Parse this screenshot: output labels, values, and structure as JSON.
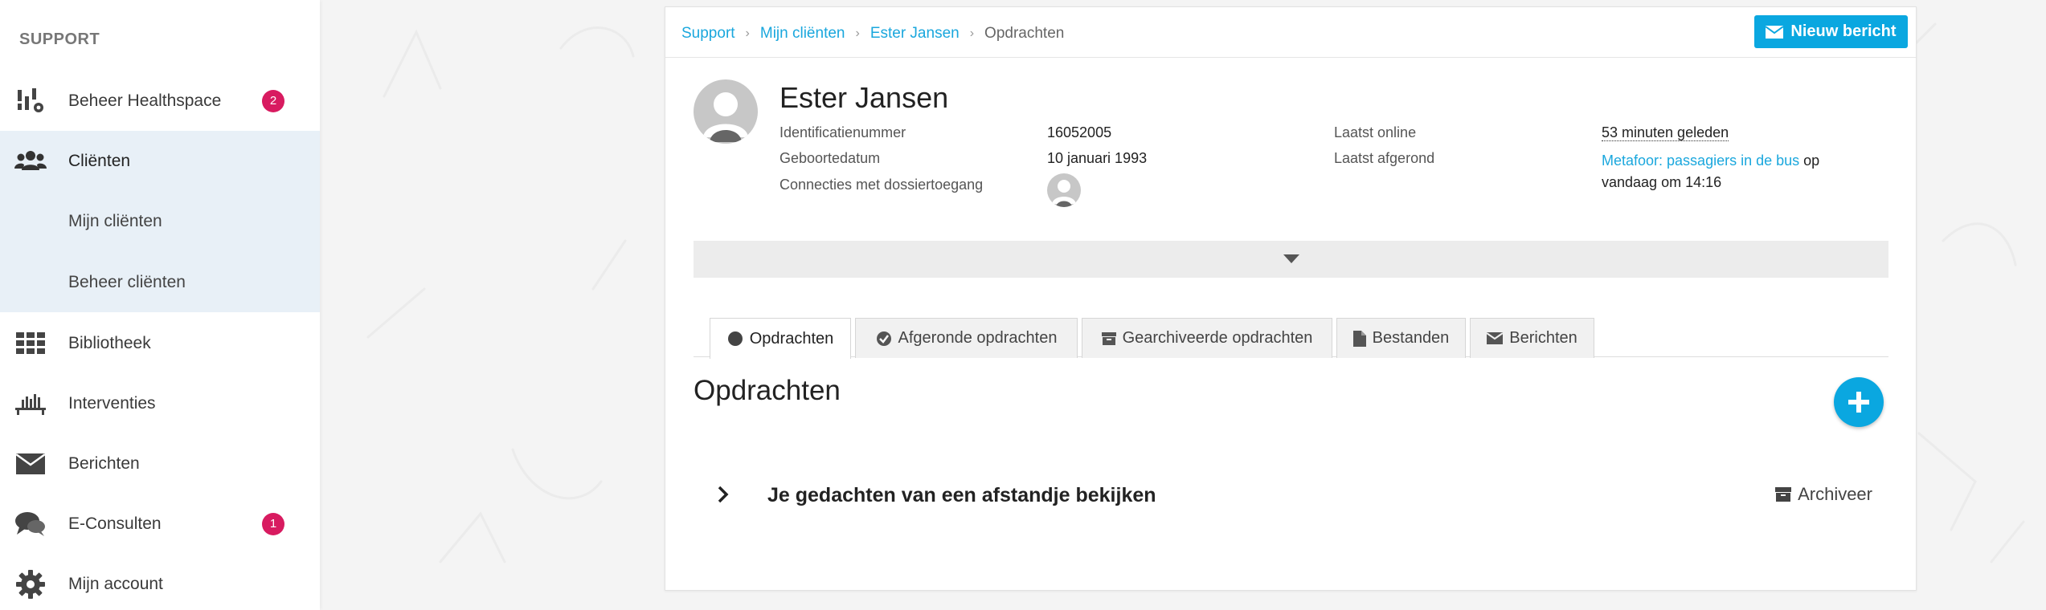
{
  "sidebar": {
    "heading": "SUPPORT",
    "items": [
      {
        "label": "Beheer Healthspace",
        "icon": "healthspace-settings-icon",
        "badge": "2"
      },
      {
        "label": "Cliënten",
        "icon": "users-icon",
        "badge": null
      },
      {
        "label": "Bibliotheek",
        "icon": "grid-icon",
        "badge": null
      },
      {
        "label": "Interventies",
        "icon": "interventions-icon",
        "badge": null
      },
      {
        "label": "Berichten",
        "icon": "envelope-icon",
        "badge": null
      },
      {
        "label": "E-Consulten",
        "icon": "chat-icon",
        "badge": "1"
      },
      {
        "label": "Mijn account",
        "icon": "gear-icon",
        "badge": null
      }
    ],
    "sub_items": [
      "Mijn cliënten",
      "Beheer cliënten"
    ],
    "active_bg": "#e8f0f7",
    "badge_color": "#d81b60"
  },
  "breadcrumb": {
    "items": [
      "Support",
      "Mijn cliënten",
      "Ester Jansen"
    ],
    "current": "Opdrachten"
  },
  "header": {
    "new_message_label": "Nieuw bericht",
    "accent": "#0aa7e0"
  },
  "client": {
    "name": "Ester Jansen",
    "id_label": "Identificatienummer",
    "id_value": "16052005",
    "dob_label": "Geboortedatum",
    "dob_value": "10 januari 1993",
    "connections_label": "Connecties met dossiertoegang",
    "last_online_label": "Laatst online",
    "last_online_value": "53 minuten geleden",
    "last_completed_label": "Laatst afgerond",
    "last_completed_link": "Metafoor: passagiers in de bus",
    "last_completed_suffix": " op",
    "last_completed_time": "vandaag om 14:16"
  },
  "tabs": [
    {
      "label": "Opdrachten",
      "icon": "circle-icon",
      "active": true
    },
    {
      "label": "Afgeronde opdrachten",
      "icon": "check-circle-icon",
      "active": false
    },
    {
      "label": "Gearchiveerde opdrachten",
      "icon": "archive-icon",
      "active": false
    },
    {
      "label": "Bestanden",
      "icon": "file-icon",
      "active": false
    },
    {
      "label": "Berichten",
      "icon": "envelope-icon",
      "active": false
    }
  ],
  "main": {
    "section_title": "Opdrachten",
    "tasks": [
      {
        "title": "Je gedachten van een afstandje bekijken",
        "archive_label": "Archiveer"
      }
    ]
  }
}
